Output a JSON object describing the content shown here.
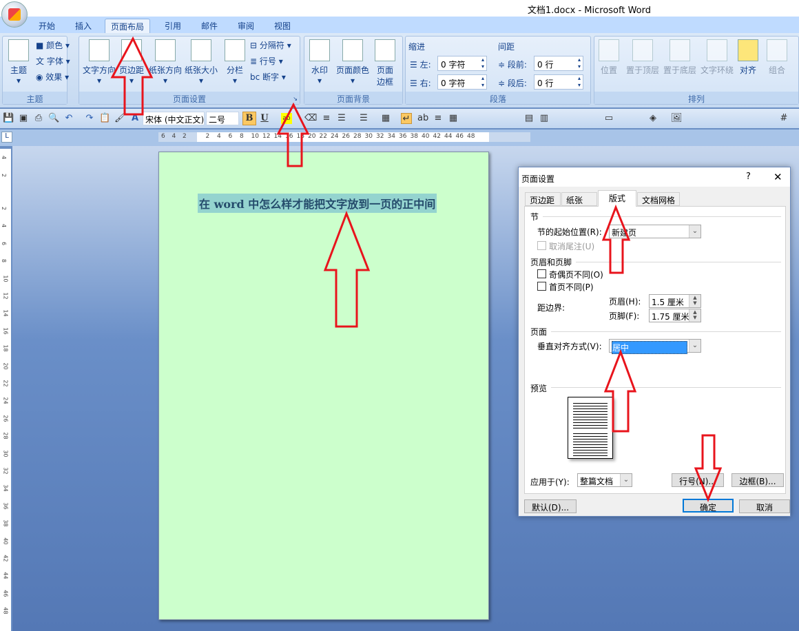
{
  "window": {
    "title": "文档1.docx - Microsoft Word"
  },
  "tabs": [
    "开始",
    "插入",
    "页面布局",
    "引用",
    "邮件",
    "审阅",
    "视图"
  ],
  "ribbon": {
    "theme": {
      "label": "主题",
      "btn": "主题",
      "colors": "颜色",
      "fonts": "字体",
      "effects": "效果"
    },
    "page_setup": {
      "label": "页面设置",
      "text_direction": "文字方向",
      "margins": "页边距",
      "orientation": "纸张方向",
      "size": "纸张大小",
      "columns": "分栏",
      "breaks": "分隔符",
      "line_numbers": "行号",
      "hyphenation": "断字"
    },
    "page_background": {
      "label": "页面背景",
      "watermark": "水印",
      "page_color": "页面颜色",
      "page_borders": "页面\n边框"
    },
    "paragraph": {
      "label": "段落",
      "indent": "缩进",
      "spacing": "间距",
      "left": "左:",
      "right": "右:",
      "before": "段前:",
      "after": "段后:",
      "left_val": "0 字符",
      "right_val": "0 字符",
      "before_val": "0 行",
      "after_val": "0 行"
    },
    "arrange": {
      "label": "排列",
      "position": "位置",
      "front": "置于顶层",
      "back": "置于底层",
      "wrap": "文字环绕",
      "align": "对齐",
      "group": "组合"
    }
  },
  "toolbar": {
    "font": "宋体 (中文正文)",
    "size": "二号",
    "bold": "B",
    "underline": "U"
  },
  "hruler": [
    "6",
    "4",
    "2",
    "2",
    "4",
    "6",
    "8",
    "10",
    "12",
    "14",
    "16",
    "18",
    "20",
    "22",
    "24",
    "26",
    "28",
    "30",
    "32",
    "34",
    "36",
    "38",
    "40",
    "42",
    "44",
    "46",
    "48"
  ],
  "vruler": [
    "4",
    "2",
    "2",
    "4",
    "6",
    "8",
    "10",
    "12",
    "14",
    "16",
    "18",
    "20",
    "22",
    "24",
    "26",
    "28",
    "30",
    "32",
    "34",
    "36",
    "38",
    "40",
    "42",
    "44",
    "46",
    "48"
  ],
  "document": {
    "text": "在 word 中怎么样才能把文字放到一页的正中间"
  },
  "dialog": {
    "title": "页面设置",
    "help": "?",
    "close": "✕",
    "tabs": [
      "页边距",
      "纸张",
      "版式",
      "文档网格"
    ],
    "section": "节",
    "section_start_label": "节的起始位置(R):",
    "section_start_value": "新建页",
    "suppress_endnotes": "取消尾注(U)",
    "header_footer": "页眉和页脚",
    "odd_even": "奇偶页不同(O)",
    "first_page": "首页不同(P)",
    "from_edge": "距边界:",
    "header_label": "页眉(H):",
    "header_value": "1.5 厘米",
    "footer_label": "页脚(F):",
    "footer_value": "1.75 厘米",
    "page": "页面",
    "valign_label": "垂直对齐方式(V):",
    "valign_value": "居中",
    "preview": "预览",
    "apply_label": "应用于(Y):",
    "apply_value": "整篇文档",
    "line_numbers": "行号(N)...",
    "borders": "边框(B)...",
    "default": "默认(D)...",
    "ok": "确定",
    "cancel": "取消"
  }
}
